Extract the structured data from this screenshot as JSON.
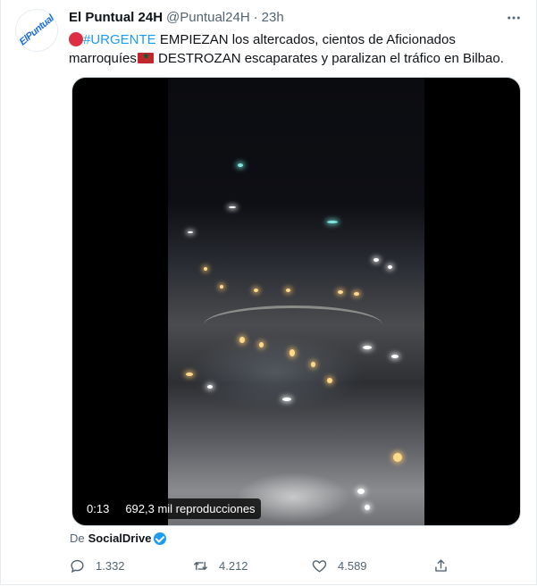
{
  "tweet": {
    "avatar_text": "ElPuntual",
    "author_name": "El Puntual 24H",
    "handle": "@Puntual24H",
    "separator": "·",
    "time": "23h",
    "more_icon": "more-dots-icon",
    "text": {
      "emoji1": "red-circle-emoji",
      "hashtag": "#URGENTE",
      "part1": " EMPIEZAN los altercados, cientos de Aficionados marroquíes",
      "flag": "morocco-flag-emoji",
      "part2": " DESTROZAN escaparates y paralizan el tráfico en Bilbao."
    },
    "video": {
      "duration": "0:13",
      "views": "692,3 mil reproducciones"
    },
    "source": {
      "prefix": "De",
      "account": "SocialDrive"
    },
    "actions": {
      "reply_count": "1.332",
      "retweet_count": "4.212",
      "like_count": "4.589"
    },
    "colors": {
      "accent": "#1d9bf0",
      "text": "#0f1419",
      "muted": "#536471"
    }
  }
}
